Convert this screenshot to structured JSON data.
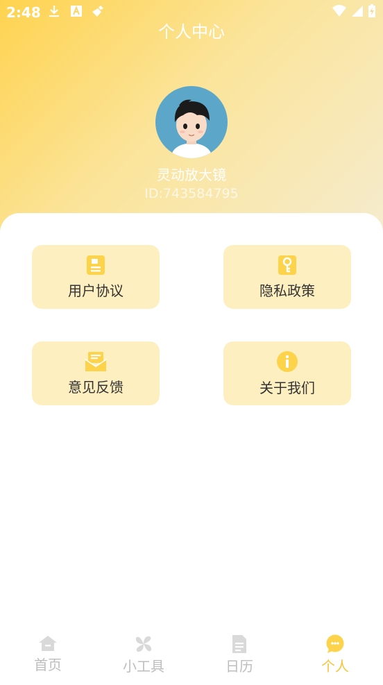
{
  "status_bar": {
    "time": "2:48"
  },
  "header": {
    "title": "个人中心"
  },
  "profile": {
    "name": "灵动放大镜",
    "id_text": "ID:743584795"
  },
  "menu": [
    {
      "label": "用户协议",
      "icon": "document-icon"
    },
    {
      "label": "隐私政策",
      "icon": "key-icon"
    },
    {
      "label": "意见反馈",
      "icon": "envelope-icon"
    },
    {
      "label": "关于我们",
      "icon": "info-icon"
    }
  ],
  "tabs": [
    {
      "label": "首页",
      "icon": "home-icon",
      "active": false
    },
    {
      "label": "小工具",
      "icon": "tools-icon",
      "active": false
    },
    {
      "label": "日历",
      "icon": "calendar-doc-icon",
      "active": false
    },
    {
      "label": "个人",
      "icon": "chat-bubble-icon",
      "active": true
    }
  ],
  "colors": {
    "accent": "#f7c53a",
    "tile_bg": "#fdefbf",
    "inactive": "#bdbdbd"
  }
}
